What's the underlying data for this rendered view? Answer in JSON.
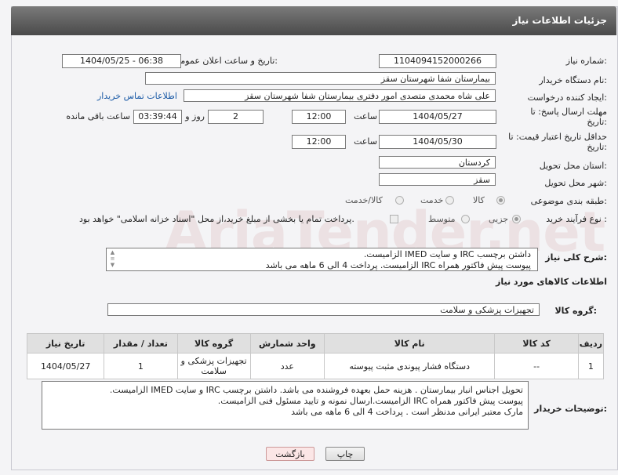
{
  "header_title": "جزئیات اطلاعات نیاز",
  "labels": {
    "need_number": "شماره نیاز:",
    "announce_datetime": "تاریخ و ساعت اعلان عمومی:",
    "buyer_org": "نام دستگاه خریدار:",
    "requester": "ایجاد کننده درخواست:",
    "send_deadline": "مهلت ارسال پاسخ: تا تاریخ:",
    "hour1": "ساعت",
    "day_and": "روز و",
    "remaining": "ساعت باقی مانده",
    "price_validity": "حداقل تاریخ اعتبار قیمت: تا تاریخ:",
    "hour2": "ساعت",
    "province": "استان محل تحویل:",
    "city": "شهر محل تحویل:",
    "category": "طبقه بندی موضوعی:",
    "process_type": "نوع فرآیند خرید :",
    "summary": "شرح کلی نیاز:",
    "goods_info": "اطلاعات کالاهای مورد نیاز",
    "goods_group": "گروه کالا:",
    "buyer_notes": "توضیحات خریدار:"
  },
  "values": {
    "need_number": "1104094152000266",
    "announce_datetime": "1404/05/25 - 06:38",
    "buyer_org": "بیمارستان شفا شهرستان سقز",
    "requester": "علی شاه محمدی متصدی امور دفتری بیمارستان شفا شهرستان سقز",
    "buyer_contact_link": "اطلاعات تماس خریدار",
    "send_date": "1404/05/27",
    "send_time": "12:00",
    "days": "2",
    "remaining_time": "03:39:44",
    "price_date": "1404/05/30",
    "price_time": "12:00",
    "province": "کردستان",
    "city": "سقز",
    "category_options": [
      "کالا",
      "خدمت",
      "کالا/خدمت"
    ],
    "process_options": [
      "جزیی",
      "متوسط"
    ],
    "payment_note": "پرداخت تمام یا بخشی از مبلغ خرید،از محل \"اسناد خزانه اسلامی\" خواهد بود.",
    "summary_line1": "داشتن برچسب IRC  و سایت  IMED  الزامیست.",
    "summary_line2": "پیوست پیش فاکتور همراه IRC  الزامیست. پرداخت 4 الی 6 ماهه می باشد",
    "goods_group": "تجهیزات پزشکی و سلامت",
    "notes_line1": "تحویل اجناس  انبار بیمارستان . هزینه حمل بعهده فروشنده می باشد.  داشتن برچسب IRC  و سایت  IMED  الزامیست.",
    "notes_line2": "پیوست پیش فاکتور همراه IRC  الزامیست.ارسال نمونه و تایید مسئول فنی الزامیست.",
    "notes_line3": "مارک معتبر ایرانی مدنظر است . پرداخت 4 الی 6 ماهه می باشد"
  },
  "table": {
    "headers": [
      "ردیف",
      "کد کالا",
      "نام کالا",
      "واحد شمارش",
      "گروه کالا",
      "تعداد / مقدار",
      "تاریخ نیاز"
    ],
    "rows": [
      [
        "1",
        "--",
        "دستگاه فشار پیوندی مثبت پیوسته",
        "عدد",
        "تجهیزات پزشکی و سلامت",
        "1",
        "1404/05/27"
      ]
    ]
  },
  "buttons": {
    "print": "چاپ",
    "back": "بازگشت"
  },
  "watermark": "AriaTender.net"
}
